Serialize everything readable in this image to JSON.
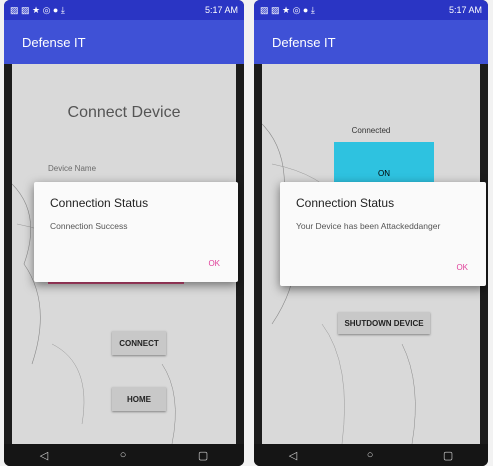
{
  "left_screen": {
    "status": {
      "left_icons": "▨ ▨ ★ ◎ ● ⤓",
      "right": "5:17 AM"
    },
    "app_title": "Defense IT",
    "heading": "Connect Device",
    "device_name_label": "Device Name",
    "connect_label": "CONNECT",
    "home_label": "HOME",
    "dialog": {
      "title": "Connection Status",
      "message": "Connection Success",
      "ok_label": "OK"
    },
    "nav": {
      "back": "◁",
      "home": "○",
      "recents": "▢"
    }
  },
  "right_screen": {
    "status": {
      "left_icons": "▨ ▨ ★ ◎ ● ⤓",
      "right": "5:17 AM"
    },
    "app_title": "Defense IT",
    "connected_label": "Connected",
    "on_label": "ON",
    "shutdown_label": "SHUTDOWN DEVICE",
    "dialog": {
      "title": "Connection Status",
      "message": "Your Device has been Attackeddanger",
      "ok_label": "OK"
    },
    "nav": {
      "back": "◁",
      "home": "○",
      "recents": "▢"
    }
  },
  "colors": {
    "status_bar": "#2a35c4",
    "app_bar": "#3f51d6",
    "accent_pink": "#e0409a",
    "on_button": "#2ec2e0"
  }
}
